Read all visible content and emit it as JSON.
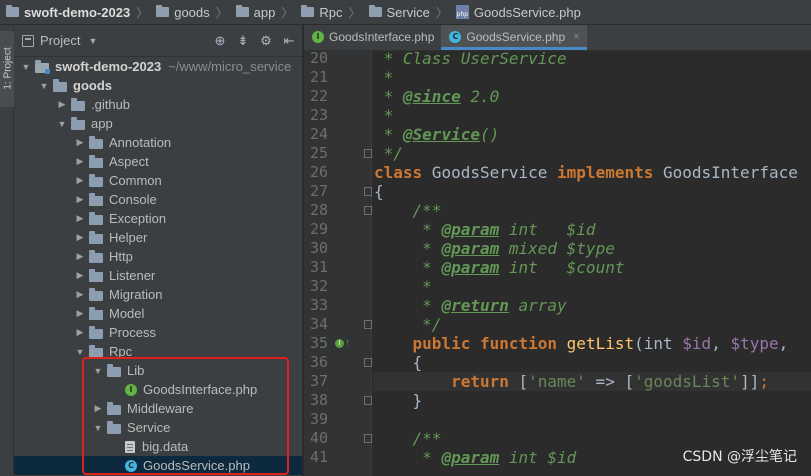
{
  "breadcrumb": {
    "items": [
      "swoft-demo-2023",
      "goods",
      "app",
      "Rpc",
      "Service",
      "GoodsService.php"
    ],
    "separator": "〉"
  },
  "tool_strip": {
    "tab_label": "1: Project"
  },
  "project_panel": {
    "title": "Project",
    "tools": {
      "locate": "⊕",
      "collapse": "⇟",
      "settings": "⚙",
      "hide": "⇤"
    },
    "tree": [
      {
        "label": "swoft-demo-2023",
        "suffix": "~/www/micro_service",
        "type": "root",
        "expanded": true,
        "depth": 0
      },
      {
        "label": "goods",
        "type": "folder",
        "expanded": true,
        "depth": 1
      },
      {
        "label": ".github",
        "type": "folder",
        "expanded": false,
        "depth": 2
      },
      {
        "label": "app",
        "type": "folder",
        "expanded": true,
        "depth": 2
      },
      {
        "label": "Annotation",
        "type": "folder",
        "expanded": false,
        "depth": 3
      },
      {
        "label": "Aspect",
        "type": "folder",
        "expanded": false,
        "depth": 3
      },
      {
        "label": "Common",
        "type": "folder",
        "expanded": false,
        "depth": 3
      },
      {
        "label": "Console",
        "type": "folder",
        "expanded": false,
        "depth": 3
      },
      {
        "label": "Exception",
        "type": "folder",
        "expanded": false,
        "depth": 3
      },
      {
        "label": "Helper",
        "type": "folder",
        "expanded": false,
        "depth": 3
      },
      {
        "label": "Http",
        "type": "folder",
        "expanded": false,
        "depth": 3
      },
      {
        "label": "Listener",
        "type": "folder",
        "expanded": false,
        "depth": 3
      },
      {
        "label": "Migration",
        "type": "folder",
        "expanded": false,
        "depth": 3
      },
      {
        "label": "Model",
        "type": "folder",
        "expanded": false,
        "depth": 3
      },
      {
        "label": "Process",
        "type": "folder",
        "expanded": false,
        "depth": 3
      },
      {
        "label": "Rpc",
        "type": "folder",
        "expanded": true,
        "depth": 3
      },
      {
        "label": "Lib",
        "type": "folder",
        "expanded": true,
        "depth": 4
      },
      {
        "label": "GoodsInterface.php",
        "type": "interface",
        "depth": 5
      },
      {
        "label": "Middleware",
        "type": "folder",
        "expanded": false,
        "depth": 4
      },
      {
        "label": "Service",
        "type": "folder",
        "expanded": true,
        "depth": 4
      },
      {
        "label": "big.data",
        "type": "file",
        "depth": 5
      },
      {
        "label": "GoodsService.php",
        "type": "class",
        "depth": 5,
        "selected": true
      }
    ]
  },
  "editor": {
    "tabs": [
      {
        "label": "GoodsInterface.php",
        "kind": "interface",
        "active": false
      },
      {
        "label": "GoodsService.php",
        "kind": "class",
        "active": true
      }
    ],
    "line_numbers": [
      "20",
      "21",
      "22",
      "23",
      "24",
      "25",
      "26",
      "27",
      "28",
      "29",
      "30",
      "31",
      "32",
      "33",
      "34",
      "35",
      "36",
      "37",
      "38",
      "39",
      "40",
      "41"
    ],
    "code_lines": [
      [
        [
          "cm",
          " * Class UserService"
        ]
      ],
      [
        [
          "cm",
          " *"
        ]
      ],
      [
        [
          "cm",
          " * "
        ],
        [
          "tag",
          "@since"
        ],
        [
          "cm",
          " 2.0"
        ]
      ],
      [
        [
          "cm",
          " *"
        ]
      ],
      [
        [
          "cm",
          " * "
        ],
        [
          "tag",
          "@Service"
        ],
        [
          "cm",
          "()"
        ]
      ],
      [
        [
          "cm",
          " */"
        ]
      ],
      [
        [
          "kw",
          "class"
        ],
        [
          "plain",
          " GoodsService "
        ],
        [
          "kw",
          "implements"
        ],
        [
          "plain",
          " GoodsInterface"
        ]
      ],
      [
        [
          "plain",
          "{"
        ]
      ],
      [
        [
          "cm",
          "    /**"
        ]
      ],
      [
        [
          "cm",
          "     * "
        ],
        [
          "tag",
          "@param"
        ],
        [
          "ty",
          " int   $id"
        ]
      ],
      [
        [
          "cm",
          "     * "
        ],
        [
          "tag",
          "@param"
        ],
        [
          "ty",
          " mixed $type"
        ]
      ],
      [
        [
          "cm",
          "     * "
        ],
        [
          "tag",
          "@param"
        ],
        [
          "ty",
          " int   $count"
        ]
      ],
      [
        [
          "cm",
          "     *"
        ]
      ],
      [
        [
          "cm",
          "     * "
        ],
        [
          "tag",
          "@return"
        ],
        [
          "ty",
          " array"
        ]
      ],
      [
        [
          "cm",
          "     */"
        ]
      ],
      [
        [
          "kw",
          "    public function"
        ],
        [
          "plain",
          " "
        ],
        [
          "fn",
          "getList"
        ],
        [
          "plain",
          "(int "
        ],
        [
          "var",
          "$id"
        ],
        [
          "plain",
          ", "
        ],
        [
          "var",
          "$type"
        ],
        [
          "plain",
          ","
        ]
      ],
      [
        [
          "plain",
          "    {"
        ]
      ],
      [
        [
          "kw",
          "        return"
        ],
        [
          "plain",
          " ["
        ],
        [
          "str",
          "'name'"
        ],
        [
          "plain",
          " => ["
        ],
        [
          "str",
          "'goodsList'"
        ],
        [
          "plain",
          "]]"
        ],
        [
          "semi",
          ";"
        ]
      ],
      [
        [
          "plain",
          "    }"
        ]
      ],
      [
        [
          "plain",
          ""
        ]
      ],
      [
        [
          "cm",
          "    /**"
        ]
      ],
      [
        [
          "cm",
          "     * "
        ],
        [
          "tag",
          "@param"
        ],
        [
          "ty",
          " int $id"
        ]
      ]
    ],
    "highlighted_line": "37"
  },
  "watermark": "CSDN @浮尘笔记"
}
